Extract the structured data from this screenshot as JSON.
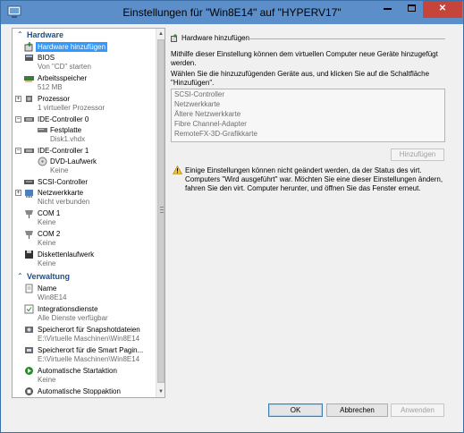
{
  "window": {
    "title": "Einstellungen für \"Win8E14\" auf \"HYPERV17\"",
    "title_bar_color": "#5c8fc9",
    "close_glyph": "✕"
  },
  "tree": {
    "hardware_header": "Hardware",
    "management_header": "Verwaltung",
    "hardware_items": [
      {
        "label": "Hardware hinzufügen",
        "sub": "",
        "icon": "add-hardware-icon"
      },
      {
        "label": "BIOS",
        "sub": "Von \"CD\" starten",
        "icon": "bios-icon"
      },
      {
        "label": "Arbeitsspeicher",
        "sub": "512 MB",
        "icon": "memory-icon"
      },
      {
        "label": "Prozessor",
        "sub": "1 virtueller Prozessor",
        "icon": "processor-icon"
      },
      {
        "label": "IDE-Controller 0",
        "sub": "",
        "icon": "ide-controller-icon"
      },
      {
        "label": "Festplatte",
        "sub": "Disk1.vhdx",
        "icon": "hard-disk-icon"
      },
      {
        "label": "IDE-Controller 1",
        "sub": "",
        "icon": "ide-controller-icon"
      },
      {
        "label": "DVD-Laufwerk",
        "sub": "Keine",
        "icon": "dvd-drive-icon"
      },
      {
        "label": "SCSI-Controller",
        "sub": "",
        "icon": "scsi-controller-icon"
      },
      {
        "label": "Netzwerkkarte",
        "sub": "Nicht verbunden",
        "icon": "network-adapter-icon"
      },
      {
        "label": "COM 1",
        "sub": "Keine",
        "icon": "com-port-icon"
      },
      {
        "label": "COM 2",
        "sub": "Keine",
        "icon": "com-port-icon"
      },
      {
        "label": "Diskettenlaufwerk",
        "sub": "Keine",
        "icon": "floppy-drive-icon"
      }
    ],
    "management_items": [
      {
        "label": "Name",
        "sub": "Win8E14",
        "icon": "name-icon"
      },
      {
        "label": "Integrationsdienste",
        "sub": "Alle Dienste verfügbar",
        "icon": "integration-services-icon"
      },
      {
        "label": "Speicherort für Snapshotdateien",
        "sub": "E:\\Virtuelle Maschinen\\Win8E14",
        "icon": "snapshot-location-icon"
      },
      {
        "label": "Speicherort für die Smart Pagin...",
        "sub": "E:\\Virtuelle Maschinen\\Win8E14",
        "icon": "smart-paging-location-icon"
      },
      {
        "label": "Automatische Startaktion",
        "sub": "Keine",
        "icon": "auto-start-icon"
      },
      {
        "label": "Automatische Stoppaktion",
        "sub": "",
        "icon": "auto-stop-icon"
      }
    ]
  },
  "pane": {
    "section_title": "Hardware hinzufügen",
    "intro": "Mithilfe dieser Einstellung können dem virtuellen Computer neue Geräte hinzugefügt werden.",
    "instruction": "Wählen Sie die hinzuzufügenden Geräte aus, und klicken Sie auf die Schaltfläche \"Hinzufügen\".",
    "device_list": [
      "SCSI-Controller",
      "Netzwerkkarte",
      "Ältere Netzwerkkarte",
      "Fibre Channel-Adapter",
      "RemoteFX-3D-Grafikkarte"
    ],
    "add_button": "Hinzufügen",
    "warning": "Einige Einstellungen können nicht geändert werden, da der Status des virt. Computers \"Wird ausgeführt\" war. Möchten Sie eine dieser Einstellungen ändern, fahren Sie den virt. Computer herunter, und öffnen Sie das Fenster erneut."
  },
  "buttons": {
    "ok": "OK",
    "cancel": "Abbrechen",
    "apply": "Anwenden"
  }
}
